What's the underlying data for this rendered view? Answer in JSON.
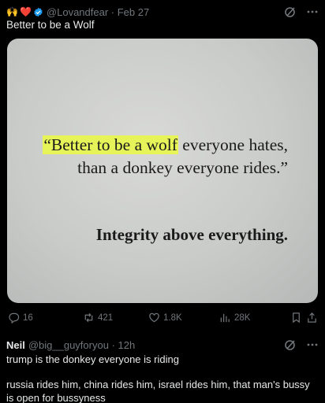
{
  "post": {
    "handle": "@Lovandfear",
    "date": "Feb 27",
    "text": "Better to be a Wolf",
    "image": {
      "highlighted": "“Better to be a wolf",
      "quote_rest": " everyone hates, than a donkey everyone rides.”",
      "tagline": "Integrity above everything."
    },
    "stats": {
      "replies": "16",
      "reposts": "421",
      "likes": "1.8K",
      "views": "28K"
    }
  },
  "reply": {
    "name": "Neil",
    "handle": "@big__guyforyou",
    "time": "12h",
    "paragraph1": "trump is the donkey everyone is riding",
    "paragraph2": "russia rides him, china rides him, israel rides him, that man's bussy is open for bussyness"
  },
  "icons": {
    "verified": "verified-badge-icon",
    "grok": "grok-icon",
    "more": "more-icon",
    "reply": "reply-icon",
    "repost": "repost-icon",
    "like": "like-icon",
    "views": "views-icon",
    "bookmark": "bookmark-icon",
    "share": "share-icon"
  },
  "colors": {
    "background": "#000000",
    "text": "#e7e9ea",
    "muted": "#71767b",
    "verified": "#1d9bf0",
    "highlight": "#e6f45a"
  }
}
